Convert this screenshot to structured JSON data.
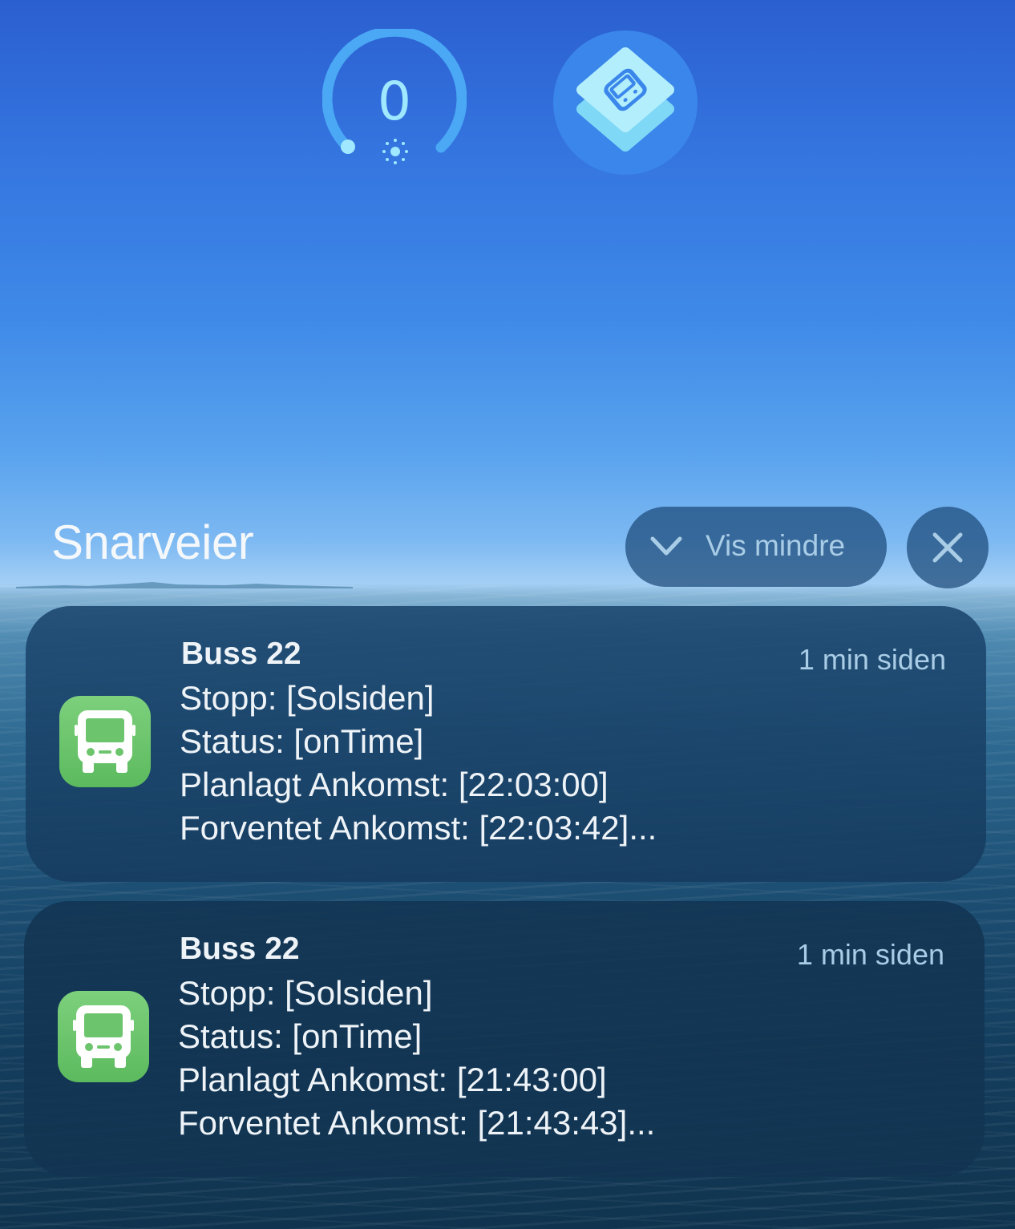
{
  "widgets": {
    "gauge_value": "0",
    "gauge_icon": "brightness-icon",
    "shortcuts_icon": "shortcuts-bus-icon"
  },
  "header": {
    "title": "Snarveier",
    "show_less_label": "Vis mindre",
    "show_less_icon": "chevron-down-icon",
    "close_icon": "close-icon"
  },
  "notifications": [
    {
      "title": "Buss 22",
      "time": "1 min siden",
      "icon": "bus-icon",
      "lines": [
        "Stopp: [Solsiden]",
        "Status: [onTime]",
        "Planlagt Ankomst: [22:03:00]",
        "Forventet Ankomst: [22:03:42]..."
      ]
    },
    {
      "title": "Buss 22",
      "time": "1 min siden",
      "icon": "bus-icon",
      "lines": [
        "Stopp: [Solsiden]",
        "Status: [onTime]",
        "Planlagt Ankomst: [21:43:00]",
        "Forventet Ankomst: [21:43:43]..."
      ]
    }
  ],
  "colors": {
    "accent": "#a9cde6",
    "icon_green": "#6cc56d",
    "gauge_blue": "#4aa8f5"
  }
}
